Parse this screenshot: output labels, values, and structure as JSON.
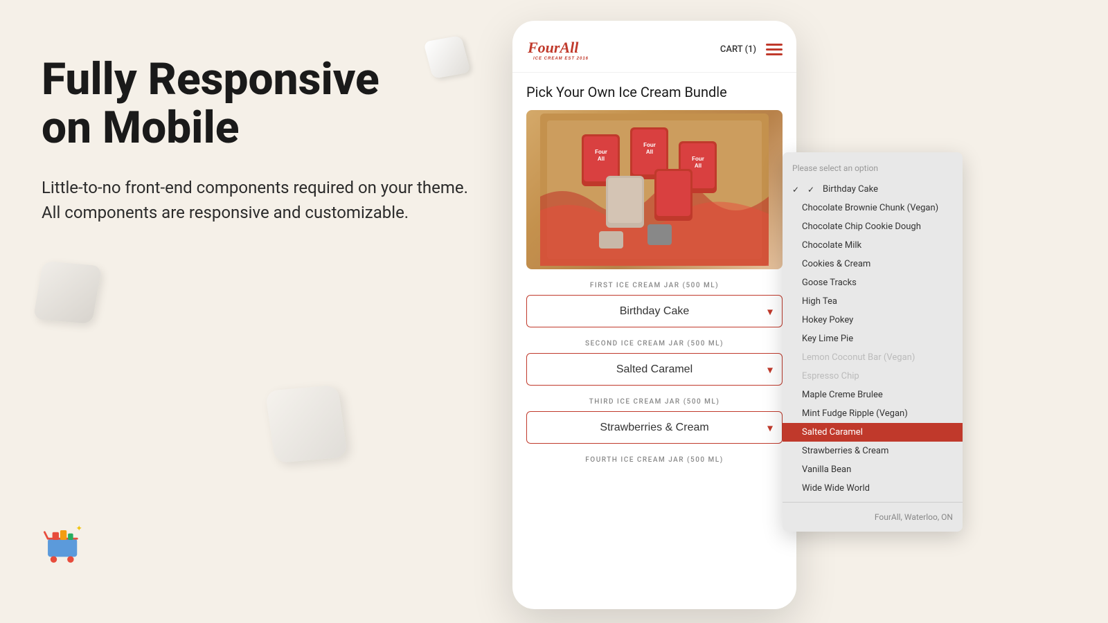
{
  "page": {
    "background_color": "#f5f0e8"
  },
  "left": {
    "heading_line1": "Fully Responsive",
    "heading_line2": "on Mobile",
    "description": "Little-to-no front-end components required on your theme. All components are responsive and customizable."
  },
  "phone": {
    "logo": "FourAll",
    "logo_sub": "ICE CREAM EST 2016",
    "cart_label": "CART (1)",
    "bundle_title": "Pick Your Own Ice Cream Bundle",
    "jar1_label": "FIRST ICE CREAM JAR (500 ML)",
    "jar1_value": "Birthday Cake",
    "jar2_label": "SECOND ICE CREAM JAR (500 ML)",
    "jar2_value": "Salted Caramel",
    "jar3_label": "THIRD ICE CREAM JAR (500 ML)",
    "jar3_value": "Strawberries & Cream",
    "jar4_label": "FOURTH ICE CREAM JAR (500 ML)"
  },
  "dropdown": {
    "placeholder": "Please select an option",
    "items": [
      {
        "label": "Birthday Cake",
        "checked": true,
        "selected": false,
        "disabled": false
      },
      {
        "label": "Chocolate Brownie Chunk (Vegan)",
        "checked": false,
        "selected": false,
        "disabled": false
      },
      {
        "label": "Chocolate Chip Cookie Dough",
        "checked": false,
        "selected": false,
        "disabled": false
      },
      {
        "label": "Chocolate Milk",
        "checked": false,
        "selected": false,
        "disabled": false
      },
      {
        "label": "Cookies & Cream",
        "checked": false,
        "selected": false,
        "disabled": false
      },
      {
        "label": "Goose Tracks",
        "checked": false,
        "selected": false,
        "disabled": false
      },
      {
        "label": "High Tea",
        "checked": false,
        "selected": false,
        "disabled": false
      },
      {
        "label": "Hokey Pokey",
        "checked": false,
        "selected": false,
        "disabled": false
      },
      {
        "label": "Key Lime Pie",
        "checked": false,
        "selected": false,
        "disabled": false
      },
      {
        "label": "Lemon Coconut Bar (Vegan)",
        "checked": false,
        "selected": false,
        "disabled": true
      },
      {
        "label": "Espresso Chip",
        "checked": false,
        "selected": false,
        "disabled": true
      },
      {
        "label": "Maple Creme Brulee",
        "checked": false,
        "selected": false,
        "disabled": false
      },
      {
        "label": "Mint Fudge Ripple (Vegan)",
        "checked": false,
        "selected": false,
        "disabled": false
      },
      {
        "label": "Salted Caramel",
        "checked": false,
        "selected": true,
        "disabled": false
      },
      {
        "label": "Strawberries & Cream",
        "checked": false,
        "selected": false,
        "disabled": false
      },
      {
        "label": "Vanilla Bean",
        "checked": false,
        "selected": false,
        "disabled": false
      },
      {
        "label": "Wide Wide World",
        "checked": false,
        "selected": false,
        "disabled": false
      }
    ],
    "footer": "FourAll, Waterloo, ON"
  }
}
